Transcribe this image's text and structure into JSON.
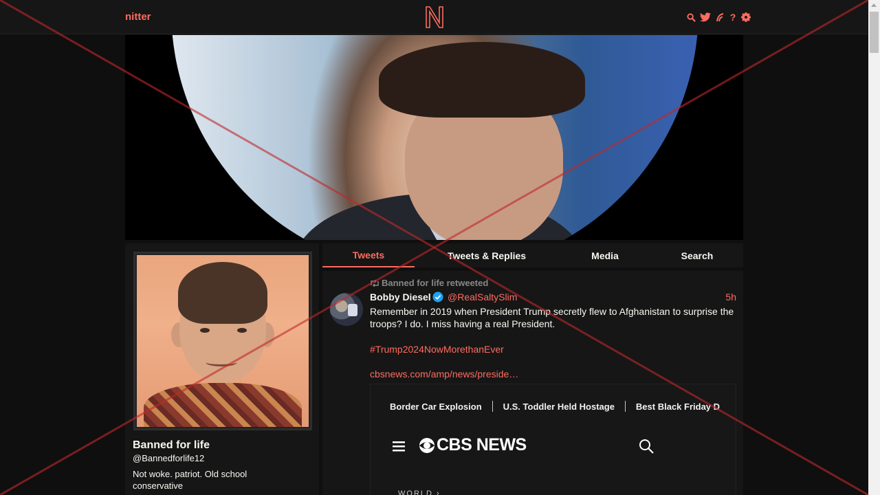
{
  "navbar": {
    "brand": "nitter",
    "logo_letter": "N",
    "icons": [
      "search-icon",
      "bird-icon",
      "rss-icon",
      "help-icon",
      "gear-icon"
    ]
  },
  "banner": {
    "description_icon": "banner-photo"
  },
  "profile": {
    "name": "Banned for life",
    "username": "@Bannedforlife12",
    "bio": "Not woke. patriot. Old school conservative"
  },
  "tabs": [
    {
      "label": "Tweets",
      "active": true
    },
    {
      "label": "Tweets & Replies",
      "active": false
    },
    {
      "label": "Media",
      "active": false
    },
    {
      "label": "Search",
      "active": false
    }
  ],
  "tweet": {
    "retweet_header": "Banned for life retweeted",
    "fullname": "Bobby Diesel",
    "username": "@RealSaltySlim",
    "date": "5h",
    "text": "Remember in 2019 when President Trump secretly flew to Afghanistan to surprise the troops? I do. I miss having a real President.",
    "hashtag": "#Trump2024NowMorethanEver",
    "link": "cbsnews.com/amp/news/preside…",
    "card": {
      "nav": [
        "Border Car Explosion",
        "U.S. Toddler Held Hostage",
        "Best Black Friday D"
      ],
      "logo_text": "CBS NEWS",
      "section": "WORLD ›"
    }
  },
  "colors": {
    "accent": "#ff6c60",
    "background": "#0f0f0f",
    "panel": "#161616",
    "muted": "#888889",
    "overlay_x": "#c0282a"
  }
}
